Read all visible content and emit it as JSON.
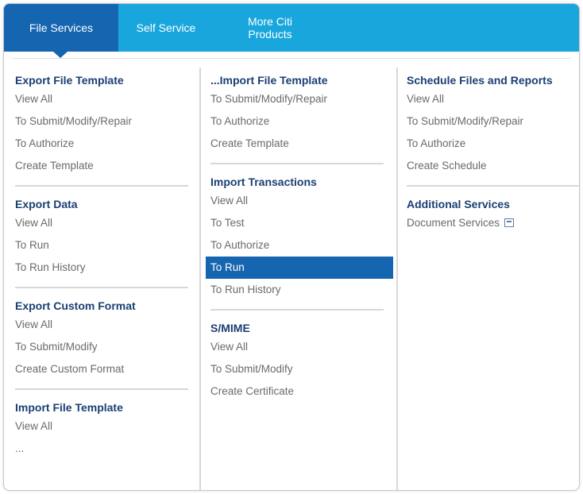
{
  "nav": {
    "tabs": [
      {
        "label": "File Services"
      },
      {
        "label": "Self Service"
      },
      {
        "label_line1": "More Citi",
        "label_line2": "Products"
      }
    ]
  },
  "col1": {
    "sections": [
      {
        "title": "Export File Template",
        "items": [
          "View All",
          "To Submit/Modify/Repair",
          "To Authorize",
          "Create Template"
        ]
      },
      {
        "title": "Export Data",
        "items": [
          "View All",
          "To Run",
          "To Run History"
        ]
      },
      {
        "title": "Export Custom Format",
        "items": [
          "View All",
          "To Submit/Modify",
          "Create Custom Format"
        ]
      },
      {
        "title": "Import File Template",
        "items": [
          "View All",
          "..."
        ]
      }
    ]
  },
  "col2": {
    "sections": [
      {
        "title": "...Import File Template",
        "items": [
          "To Submit/Modify/Repair",
          "To Authorize",
          "Create Template"
        ]
      },
      {
        "title": "Import Transactions",
        "items": [
          "View All",
          "To Test",
          "To Authorize",
          "To Run",
          "To Run History"
        ]
      },
      {
        "title": "S/MIME",
        "items": [
          "View All",
          "To Submit/Modify",
          "Create Certificate"
        ]
      }
    ]
  },
  "col3": {
    "sections": [
      {
        "title": "Schedule Files and Reports",
        "items": [
          "View All",
          "To Submit/Modify/Repair",
          "To Authorize",
          "Create Schedule"
        ]
      },
      {
        "title": "Additional Services",
        "items": [
          "Document Services"
        ]
      }
    ]
  },
  "colors": {
    "nav_bg": "#19a6dc",
    "active_tab": "#1565b0",
    "section_title": "#1a3f73",
    "item_text": "#6a6a6a"
  }
}
